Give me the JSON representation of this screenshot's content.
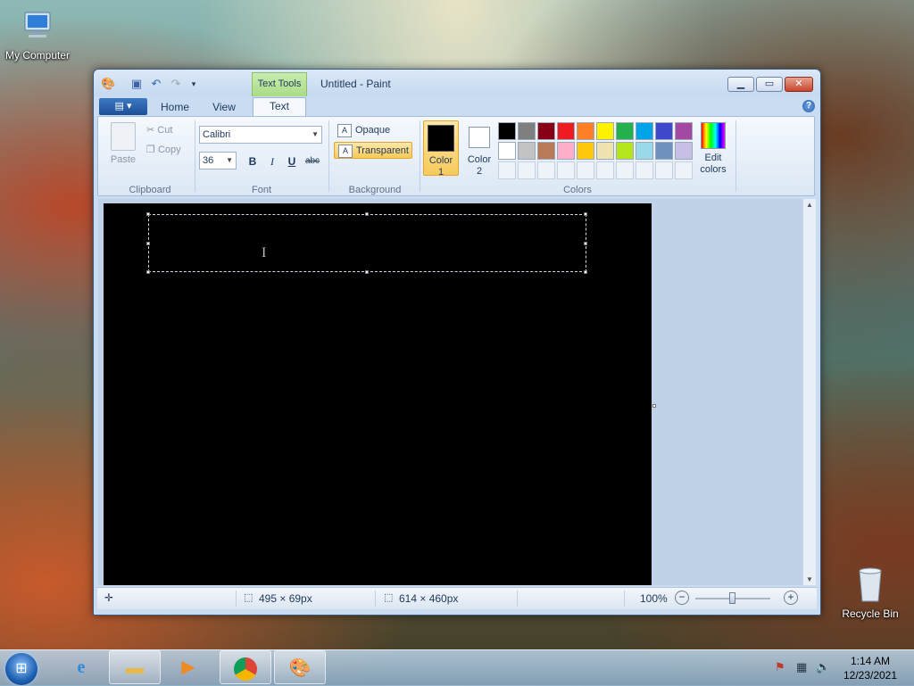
{
  "desktop": {
    "my_computer": "My Computer",
    "recycle_bin": "Recycle Bin"
  },
  "window": {
    "context_tab": "Text Tools",
    "title": "Untitled - Paint"
  },
  "tabs": [
    {
      "label": "Home"
    },
    {
      "label": "View"
    },
    {
      "label": "Text"
    }
  ],
  "ribbon": {
    "clipboard": {
      "paste": "Paste",
      "cut": "Cut",
      "copy": "Copy",
      "label": "Clipboard"
    },
    "font": {
      "family": "Calibri",
      "size": "36",
      "bold": "B",
      "italic": "I",
      "underline": "U",
      "strike": "abc",
      "label": "Font"
    },
    "background": {
      "opaque": "Opaque",
      "transparent": "Transparent",
      "label": "Background"
    },
    "colors": {
      "color1": "Color 1",
      "color2": "Color 2",
      "edit": "Edit colors",
      "label": "Colors",
      "color1_value": "#000000",
      "color2_value": "#ffffff",
      "row1": [
        "#000000",
        "#7f7f7f",
        "#880015",
        "#ed1c24",
        "#ff7f27",
        "#fff200",
        "#22b14c",
        "#00a2e8",
        "#3f48cc",
        "#a349a4"
      ],
      "row2": [
        "#ffffff",
        "#c3c3c3",
        "#b97a57",
        "#ffaec9",
        "#ffc90e",
        "#efe4b0",
        "#b5e61d",
        "#99d9ea",
        "#7092be",
        "#c8bfe7"
      ]
    }
  },
  "status": {
    "selection_size": "495 × 69px",
    "image_size": "614 × 460px",
    "zoom": "100%"
  },
  "taskbar": {
    "time": "1:14 AM",
    "date": "12/23/2021"
  }
}
